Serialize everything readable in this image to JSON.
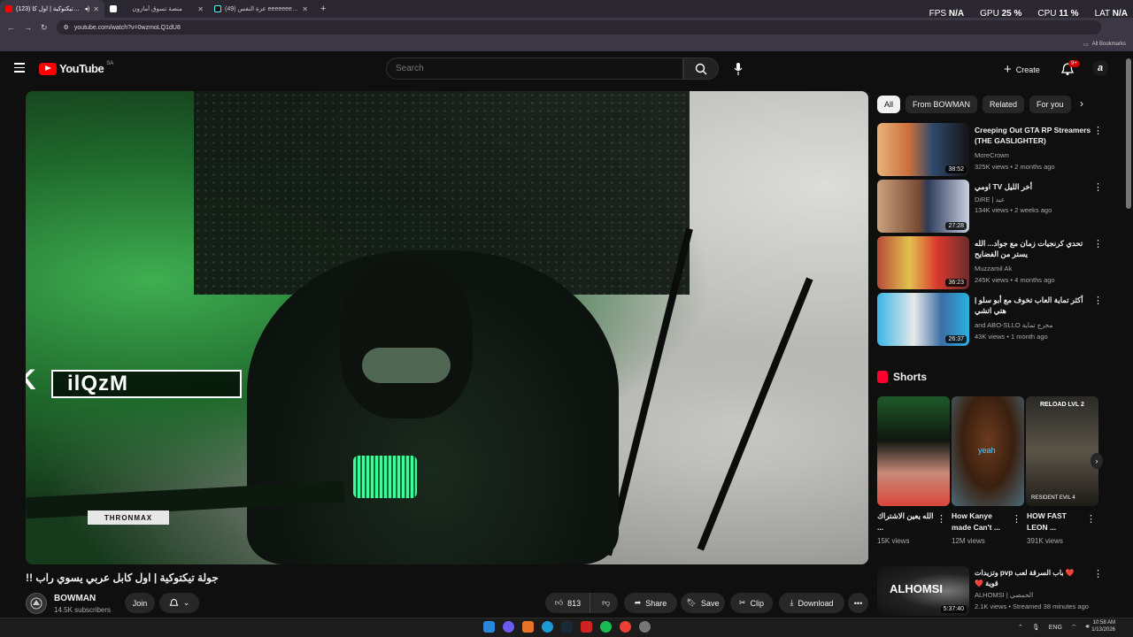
{
  "browser": {
    "tabs": [
      {
        "title": "(123) جولة تيكتوكية | اول كا",
        "active": true
      },
      {
        "title": "منصة تسوق أمازون",
        "active": false
      },
      {
        "title": "(49) عزة النفس eeeeeeeeeeee",
        "active": false
      }
    ],
    "new_tab": "+",
    "url": "youtube.com/watch?v=0wzmoLQ1dU8",
    "all_bookmarks": "All Bookmarks",
    "overlay": {
      "fps_label": "FPS",
      "fps_value": "N/A",
      "gpu_label": "GPU",
      "gpu_value": "25",
      "cpu_label": "CPU",
      "cpu_value": "11",
      "lat_label": "LAT",
      "lat_value": "N/A",
      "percent": "%"
    }
  },
  "header": {
    "logo_text": "YouTube",
    "region": "SA",
    "search_placeholder": "Search",
    "create_label": "Create",
    "notification_count": "9+",
    "avatar_letter": "a"
  },
  "player": {
    "overlay_name": "ilQzM",
    "k_mark": "K",
    "arm_tag": "THRONMAX"
  },
  "video": {
    "title": "جولة تيكتوكية | اول كابل عربي يسوي راب !!",
    "channel": "BOWMAN",
    "subscribers": "14.5K subscribers",
    "join_label": "Join",
    "likes": "813",
    "share_label": "Share",
    "save_label": "Save",
    "clip_label": "Clip",
    "download_label": "Download"
  },
  "sidebar": {
    "chips": [
      "All",
      "From BOWMAN",
      "Related",
      "For you"
    ],
    "videos": [
      {
        "title": "Creeping Out GTA RP Streamers (THE GASLIGHTER)",
        "channel": "MoreCrown",
        "meta": "325K views • 2 months ago",
        "duration": "38:52"
      },
      {
        "title": "اومي TV أخر الليل",
        "channel": "DiRE | عيد",
        "meta": "134K views • 2 weeks ago",
        "duration": "27:28"
      },
      {
        "title": "تحدي كرنجيات زمان مع جواد... الله يستر من الفضايح",
        "channel": "Muzzamil Ak",
        "meta": "245K views • 4 months ago",
        "duration": "36:23"
      },
      {
        "title": "أكثر تماية العاب تخوف مع أبو سلو | هتي اتشي",
        "channel": "and ABO-SLLO مخرج تماية",
        "meta": "43K views • 1 month ago",
        "duration": "26:37"
      }
    ],
    "shorts_heading": "Shorts",
    "shorts": [
      {
        "title": "الله يعين الاشتراك ...",
        "views": "15K views"
      },
      {
        "title": "How Kanye made Can't ...",
        "views": "12M views"
      },
      {
        "title": "HOW FAST LEON ...",
        "views": "391K views"
      }
    ],
    "short_labels": {
      "yeah": "yeah",
      "reload": "RELOAD LVL 2",
      "resident": "RESIDENT EVIL 4"
    },
    "live": {
      "thumb_name": "ALHOMSI",
      "title": "❤️ باب السرقة لعب pvp وتزيدات قوية ❤️",
      "channel": "ALHOMSI | الحمصي",
      "meta": "2.1K views • Streamed 38 minutes ago",
      "duration": "5:37:40"
    }
  },
  "taskbar": {
    "lang": "ENG",
    "time": "10:58 AM",
    "date": "1/13/2026"
  },
  "colors": {
    "accent": "#ff0000",
    "bg": "#0f0f0f",
    "chip": "#272727"
  }
}
